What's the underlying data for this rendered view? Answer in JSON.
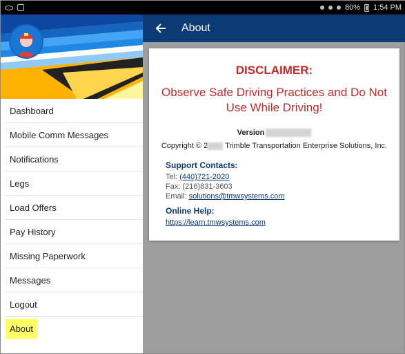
{
  "status_bar": {
    "battery": "80%",
    "time": "1:54 PM"
  },
  "drawer": {
    "menu": [
      {
        "label": "Dashboard"
      },
      {
        "label": "Mobile Comm Messages"
      },
      {
        "label": "Notifications"
      },
      {
        "label": "Legs"
      },
      {
        "label": "Load Offers"
      },
      {
        "label": "Pay History"
      },
      {
        "label": "Missing Paperwork"
      },
      {
        "label": "Messages"
      },
      {
        "label": "Logout"
      },
      {
        "label": "About"
      }
    ]
  },
  "appbar": {
    "title": "About"
  },
  "about": {
    "disclaimer_title": "DISCLAIMER:",
    "disclaimer_text": "Observe Safe Driving Practices and Do Not Use While Driving!",
    "version_label": "Version",
    "copyright_prefix": "Copyright © 2",
    "copyright_suffix": " Trimble Transportation Enterprise Solutions, Inc.",
    "support_heading": "Support Contacts:",
    "tel_label": "Tel: ",
    "tel_value": "(440)721-2020",
    "fax_line": "Fax: (216)831-3603",
    "email_label": "Email: ",
    "email_value": "solutions@tmwsystems.com",
    "help_heading": "Online Help:",
    "help_url": "https://learn.tmwsystems.com"
  },
  "colors": {
    "appbar": "#0b3a74",
    "disclaimer": "#c62828",
    "highlight": "#ffff66"
  }
}
